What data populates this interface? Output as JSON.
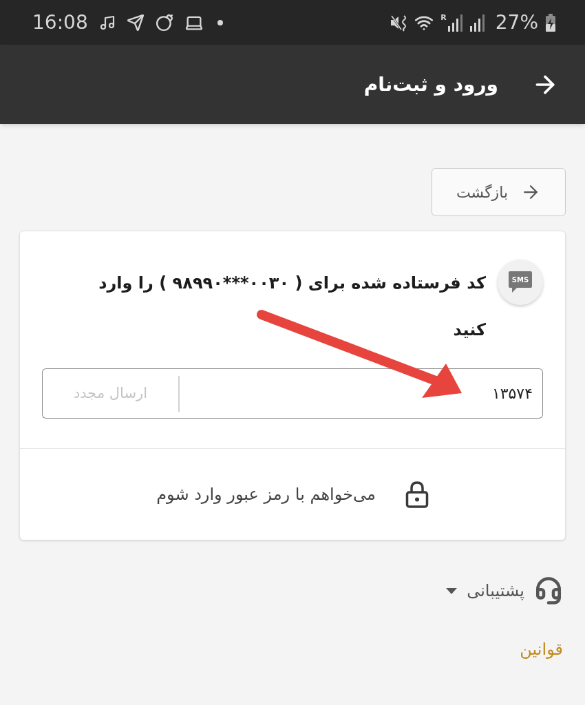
{
  "status_bar": {
    "time": "16:08",
    "roaming_mark": "R",
    "battery": "27%"
  },
  "header": {
    "title": "ورود و ثبت‌نام"
  },
  "back_button": {
    "label": "بازگشت"
  },
  "card": {
    "sms_badge": "SMS",
    "prompt": {
      "before": "کد فرستاده شده برای ( ",
      "phone": "۹۸۹۹۰***۰۰۳۰",
      "after": " ) را وارد کنید"
    },
    "code_field": {
      "value": "۱۳۵۷۴"
    },
    "resend_button": {
      "label": "ارسال مجدد",
      "disabled": true
    },
    "password_login": {
      "label": "می‌خواهم با رمز عبور وارد شوم"
    }
  },
  "footer": {
    "support": {
      "label": "پشتیبانی",
      "expanded": false
    },
    "terms": {
      "label": "قوانین"
    }
  }
}
